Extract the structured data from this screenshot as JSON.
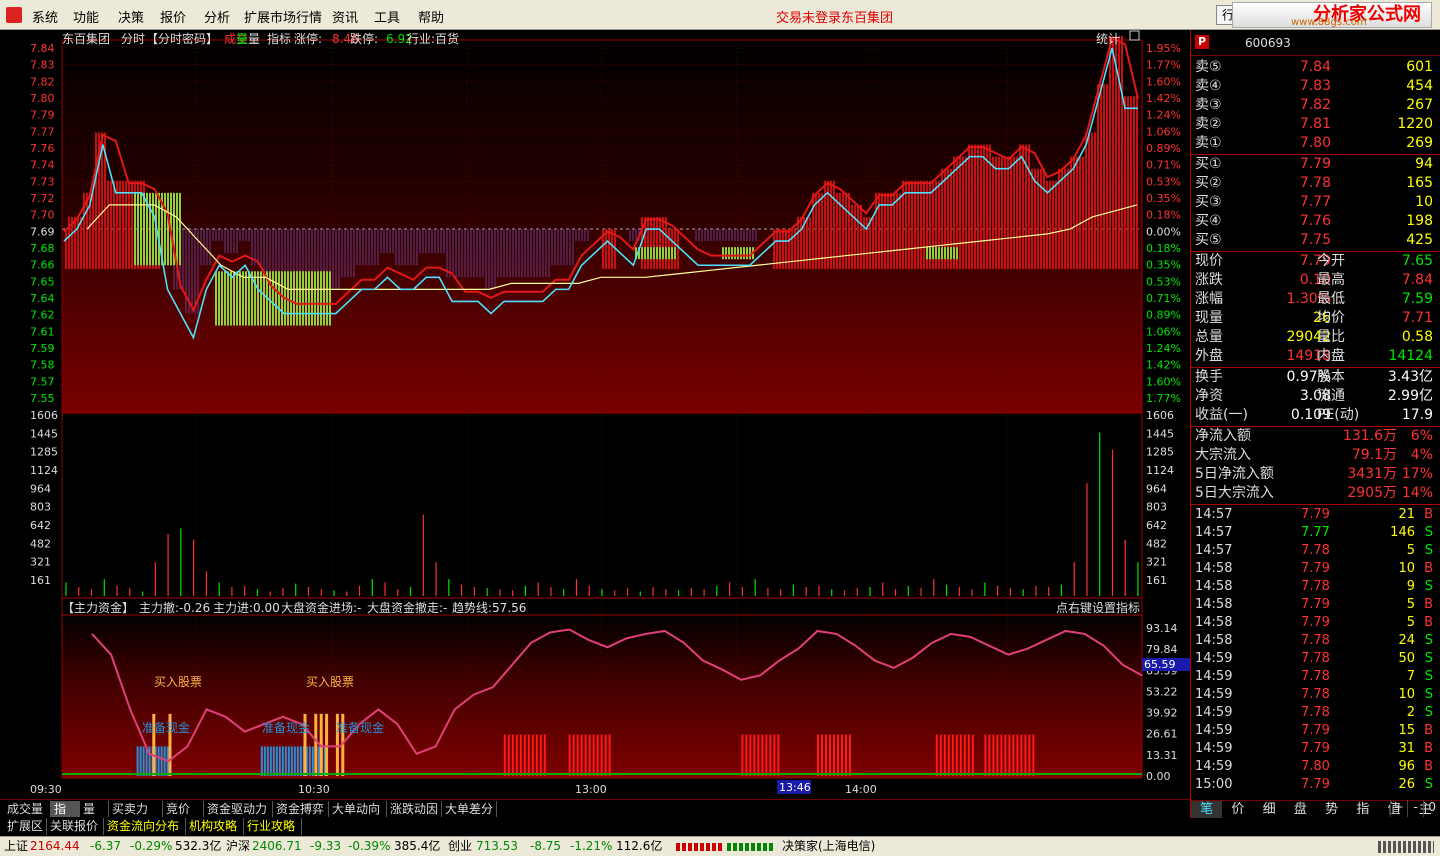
{
  "menubar": {
    "items": [
      "系统",
      "功能",
      "决策",
      "报价",
      "分析",
      "扩展市场行情",
      "资讯",
      "工具",
      "帮助"
    ],
    "center_status": "交易未登录",
    "center_stock": "东百集团",
    "trade_button": "行",
    "brand": "分析家公式网",
    "brand_url": "www.88gs.com"
  },
  "chart_header": {
    "stock_name": "东百集团",
    "mode": "分时",
    "password": "【分时密码】",
    "vol_label_1": "成交",
    "vol_label_2": "量",
    "indicator": "指标",
    "limit_up_label": "涨停:",
    "limit_up": "8.46",
    "limit_down_label": "跌停:",
    "limit_down": "6.92",
    "industry": "行业:百货",
    "stats_button": "统计"
  },
  "indicator_header": {
    "title": "【主力资金】",
    "main_out": "主力撤:-0.26",
    "main_in": "主力进:0.00",
    "big_in": "大盘资金进场:-",
    "big_out": "大盘资金撤走:-",
    "trend": "趋势线:57.56",
    "right_hint": "点右键设置指标"
  },
  "colors": {
    "up": "#ff3232",
    "down": "#00e600",
    "bg": "#000000",
    "grid": "#a00000",
    "price_line": "#4de0ff",
    "avg_line": "#ffff99",
    "trend_line": "#e0407a"
  },
  "chart_data": [
    {
      "type": "line",
      "title": "分时",
      "price_ticks": [
        "7.84",
        "7.83",
        "7.82",
        "7.80",
        "7.79",
        "7.77",
        "7.76",
        "7.74",
        "7.73",
        "7.72",
        "7.70",
        "7.69",
        "7.68",
        "7.66",
        "7.65",
        "7.64",
        "7.62",
        "7.61",
        "7.59",
        "7.58",
        "7.57",
        "7.55"
      ],
      "pct_ticks": [
        "1.95%",
        "1.77%",
        "1.60%",
        "1.42%",
        "1.24%",
        "1.06%",
        "0.89%",
        "0.71%",
        "0.53%",
        "0.35%",
        "0.18%",
        "0.00%",
        "0.18%",
        "0.35%",
        "0.53%",
        "0.71%",
        "0.89%",
        "1.06%",
        "1.24%",
        "1.42%",
        "1.60%",
        "1.77%"
      ],
      "ylim": [
        7.55,
        7.84
      ],
      "prev_close": 7.69,
      "x_ticks": [
        "09:30",
        "10:30",
        "13:00",
        "14:00"
      ],
      "cursor_time": "13:46",
      "price": [
        7.68,
        7.69,
        7.71,
        7.76,
        7.72,
        7.72,
        7.72,
        7.7,
        7.64,
        7.62,
        7.6,
        7.64,
        7.66,
        7.65,
        7.66,
        7.64,
        7.63,
        7.62,
        7.62,
        7.62,
        7.62,
        7.62,
        7.63,
        7.64,
        7.64,
        7.65,
        7.64,
        7.64,
        7.65,
        7.65,
        7.63,
        7.63,
        7.63,
        7.62,
        7.63,
        7.63,
        7.63,
        7.63,
        7.64,
        7.64,
        7.66,
        7.67,
        7.68,
        7.67,
        7.66,
        7.69,
        7.69,
        7.68,
        7.67,
        7.66,
        7.66,
        7.66,
        7.66,
        7.66,
        7.67,
        7.68,
        7.68,
        7.69,
        7.71,
        7.72,
        7.71,
        7.7,
        7.69,
        7.71,
        7.71,
        7.72,
        7.72,
        7.72,
        7.73,
        7.74,
        7.75,
        7.75,
        7.74,
        7.74,
        7.75,
        7.73,
        7.72,
        7.73,
        7.74,
        7.76,
        7.8,
        7.84,
        7.79,
        7.79
      ],
      "avg": [
        7.69,
        7.71,
        7.71,
        7.71,
        7.7,
        7.68,
        7.66,
        7.65,
        7.65,
        7.64,
        7.64,
        7.64,
        7.64,
        7.64,
        7.64,
        7.64,
        7.64,
        7.64,
        7.64,
        7.645,
        7.645,
        7.645,
        7.645,
        7.65,
        7.65,
        7.65,
        7.652,
        7.654,
        7.656,
        7.658,
        7.66,
        7.662,
        7.664,
        7.666,
        7.668,
        7.67,
        7.672,
        7.674,
        7.676,
        7.678,
        7.68,
        7.682,
        7.684,
        7.686,
        7.69,
        7.7,
        7.705,
        7.71
      ]
    },
    {
      "type": "bar",
      "title": "成交量",
      "vol_ticks": [
        "1606",
        "1445",
        "1285",
        "1124",
        "964",
        "803",
        "642",
        "482",
        "321",
        "161"
      ],
      "ylim": [
        0,
        1606
      ],
      "values": [
        120,
        80,
        60,
        150,
        90,
        70,
        40,
        300,
        550,
        600,
        500,
        220,
        120,
        80,
        90,
        60,
        40,
        70,
        110,
        80,
        60,
        50,
        40,
        90,
        150,
        120,
        60,
        80,
        720,
        300,
        150,
        100,
        80,
        70,
        60,
        50,
        90,
        120,
        80,
        60,
        150,
        90,
        60,
        50,
        70,
        40,
        80,
        60,
        50,
        70,
        60,
        90,
        120,
        80,
        150,
        70,
        60,
        100,
        80,
        90,
        60,
        50,
        70,
        80,
        120,
        60,
        90,
        70,
        150,
        100,
        80,
        60,
        120,
        90,
        70,
        60,
        90,
        80,
        100,
        300,
        1000,
        1450,
        1300,
        500,
        300
      ]
    },
    {
      "type": "line",
      "title": "主力资金",
      "ind_ticks": [
        "93.14",
        "79.84",
        "65.59",
        "53.22",
        "39.92",
        "26.61",
        "13.31",
        "0.00"
      ],
      "current_value": "65.59",
      "ylim": [
        0,
        100
      ],
      "trend": [
        96,
        82,
        45,
        15,
        10,
        20,
        45,
        40,
        30,
        35,
        40,
        35,
        20,
        20,
        35,
        45,
        35,
        15,
        20,
        45,
        55,
        60,
        75,
        90,
        97,
        99,
        92,
        87,
        93,
        96,
        98,
        90,
        78,
        72,
        65,
        68,
        78,
        86,
        98,
        96,
        88,
        78,
        73,
        80,
        90,
        96,
        94,
        88,
        82,
        86,
        92,
        98,
        96,
        88,
        75,
        68
      ],
      "buy_signal_label": "买入股票",
      "prepare_label": "准备现金",
      "red_blocks": [
        [
          0.41,
          0.45
        ],
        [
          0.47,
          0.51
        ],
        [
          0.63,
          0.665
        ],
        [
          0.7,
          0.73
        ],
        [
          0.81,
          0.845
        ],
        [
          0.855,
          0.9
        ]
      ]
    }
  ],
  "quote": {
    "header_code": "600693",
    "sell": [
      {
        "label": "卖⑤",
        "price": "7.84",
        "vol": "601"
      },
      {
        "label": "卖④",
        "price": "7.83",
        "vol": "454"
      },
      {
        "label": "卖③",
        "price": "7.82",
        "vol": "267"
      },
      {
        "label": "卖②",
        "price": "7.81",
        "vol": "1220"
      },
      {
        "label": "卖①",
        "price": "7.80",
        "vol": "269"
      }
    ],
    "buy": [
      {
        "label": "买①",
        "price": "7.79",
        "vol": "94"
      },
      {
        "label": "买②",
        "price": "7.78",
        "vol": "165"
      },
      {
        "label": "买③",
        "price": "7.77",
        "vol": "10"
      },
      {
        "label": "买④",
        "price": "7.76",
        "vol": "198"
      },
      {
        "label": "买⑤",
        "price": "7.75",
        "vol": "425"
      }
    ],
    "stats": [
      {
        "l": "现价",
        "v": "7.79",
        "l2": "今开",
        "v2": "7.65"
      },
      {
        "l": "涨跌",
        "v": "0.10",
        "l2": "最高",
        "v2": "7.84"
      },
      {
        "l": "涨幅",
        "v": "1.30%",
        "l2": "最低",
        "v2": "7.59"
      },
      {
        "l": "现量",
        "v": "26",
        "l2": "均价",
        "v2": "7.71"
      },
      {
        "l": "总量",
        "v": "29042",
        "l2": "量比",
        "v2": "0.58"
      },
      {
        "l": "外盘",
        "v": "14918",
        "l2": "内盘",
        "v2": "14124"
      }
    ],
    "fund": [
      {
        "l": "换手",
        "v": "0.97%",
        "l2": "股本",
        "v2": "3.43亿"
      },
      {
        "l": "净资",
        "v": "3.08",
        "l2": "流通",
        "v2": "2.99亿"
      },
      {
        "l": "收益(一)",
        "v": "0.109",
        "l2": "PE(动)",
        "v2": "17.9"
      }
    ],
    "flows": [
      {
        "l": "净流入额",
        "v": "131.6万",
        "p": "6%"
      },
      {
        "l": "大宗流入",
        "v": "79.1万",
        "p": "4%"
      },
      {
        "l": "5日净流入额",
        "v": "3431万",
        "p": "17%"
      },
      {
        "l": "5日大宗流入",
        "v": "2905万",
        "p": "14%"
      }
    ],
    "ticks": [
      {
        "t": "14:57",
        "p": "7.79",
        "v": "21",
        "s": "B"
      },
      {
        "t": "14:57",
        "p": "7.77",
        "v": "146",
        "s": "S"
      },
      {
        "t": "14:57",
        "p": "7.78",
        "v": "5",
        "s": "S"
      },
      {
        "t": "14:58",
        "p": "7.79",
        "v": "10",
        "s": "B"
      },
      {
        "t": "14:58",
        "p": "7.78",
        "v": "9",
        "s": "S"
      },
      {
        "t": "14:58",
        "p": "7.79",
        "v": "5",
        "s": "B"
      },
      {
        "t": "14:58",
        "p": "7.79",
        "v": "5",
        "s": "B"
      },
      {
        "t": "14:58",
        "p": "7.78",
        "v": "24",
        "s": "S"
      },
      {
        "t": "14:59",
        "p": "7.78",
        "v": "50",
        "s": "S"
      },
      {
        "t": "14:59",
        "p": "7.78",
        "v": "7",
        "s": "S"
      },
      {
        "t": "14:59",
        "p": "7.78",
        "v": "10",
        "s": "S"
      },
      {
        "t": "14:59",
        "p": "7.78",
        "v": "2",
        "s": "S"
      },
      {
        "t": "14:59",
        "p": "7.79",
        "v": "15",
        "s": "B"
      },
      {
        "t": "14:59",
        "p": "7.79",
        "v": "31",
        "s": "B"
      },
      {
        "t": "14:59",
        "p": "7.80",
        "v": "96",
        "s": "B"
      },
      {
        "t": "15:00",
        "p": "7.79",
        "v": "26",
        "s": "S"
      }
    ],
    "bottom_tabs": [
      "笔",
      "价",
      "细",
      "盘",
      "势",
      "指",
      "值",
      "主"
    ]
  },
  "tabs_row1": [
    "成交量",
    "指标",
    "量比",
    "买卖力道",
    "竞价图",
    "资金驱动力",
    "资金搏弈",
    "大单动向",
    "涨跌动因",
    "大单差分"
  ],
  "tabs_row2": [
    "扩展区",
    "关联报价",
    "资金流向分布",
    "机构攻略",
    "行业攻略"
  ],
  "ctrls": [
    "+",
    "-",
    "0"
  ],
  "status": {
    "sh_label": "上证",
    "sh_value": "2164.44",
    "sh_change": "-6.37",
    "sh_pct": "-0.29%",
    "sh_amount": "532.3亿",
    "sz_label": "沪深",
    "sz_value": "2406.71",
    "sz_change": "-9.33",
    "sz_pct": "-0.39%",
    "sz_amount": "385.4亿",
    "cy_label": "创业",
    "cy_value": "713.53",
    "cy_change": "-8.75",
    "cy_pct": "-1.21%",
    "cy_amount": "112.6亿",
    "app": "决策家(上海电信)"
  }
}
